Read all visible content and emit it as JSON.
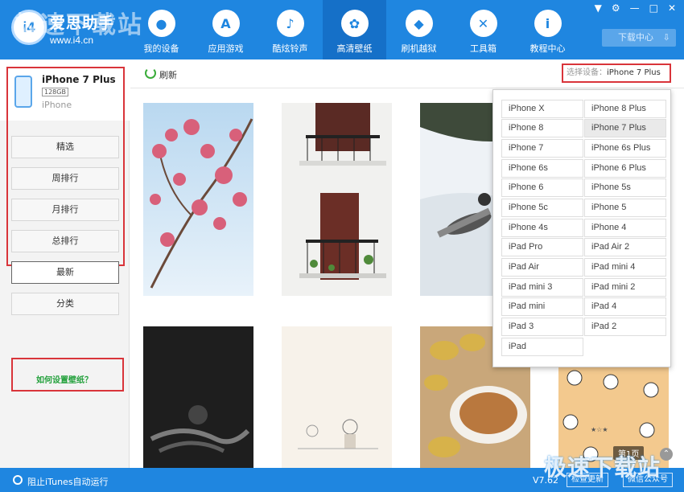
{
  "brand": {
    "name": "爱思助手",
    "url": "www.i4.cn",
    "logo_text": "i4"
  },
  "watermark": {
    "top": "极速下载站",
    "bottom": "极速下载站"
  },
  "nav": [
    {
      "label": "我的设备",
      "icon": "apple-icon"
    },
    {
      "label": "应用游戏",
      "icon": "appstore-icon"
    },
    {
      "label": "酷炫铃声",
      "icon": "bell-icon"
    },
    {
      "label": "高清壁纸",
      "icon": "flower-icon"
    },
    {
      "label": "刷机越狱",
      "icon": "dropbox-icon"
    },
    {
      "label": "工具箱",
      "icon": "tools-icon"
    },
    {
      "label": "教程中心",
      "icon": "info-icon"
    }
  ],
  "download_center": "下载中心",
  "device": {
    "name": "iPhone 7 Plus",
    "capacity": "128GB",
    "model": "iPhone"
  },
  "sidebar": {
    "buttons": [
      "精选",
      "周排行",
      "月排行",
      "总排行",
      "最新",
      "分类"
    ],
    "help": "如何设置壁纸？"
  },
  "toolbar": {
    "refresh": "刷新",
    "select_label": "选择设备：",
    "select_value": "iPhone 7 Plus"
  },
  "dropdown": [
    "iPhone X",
    "iPhone 8 Plus",
    "iPhone 8",
    "iPhone 7 Plus",
    "iPhone 7",
    "iPhone 6s Plus",
    "iPhone 6s",
    "iPhone 6 Plus",
    "iPhone 6",
    "iPhone 5s",
    "iPhone 5c",
    "iPhone 5",
    "iPhone 4s",
    "iPhone 4",
    "iPad Pro",
    "iPad Air 2",
    "iPad Air",
    "iPad mini 4",
    "iPad mini 3",
    "iPad mini 2",
    "iPad mini",
    "iPad 4",
    "iPad 3",
    "iPad 2",
    "iPad"
  ],
  "page_badge": "第1页",
  "status": {
    "itunes": "阻止iTunes自动运行",
    "version": "V7.62",
    "check_update": "检查更新",
    "wechat": "微信公众号"
  },
  "colors": {
    "brand_blue": "#1f86e0",
    "highlight_red": "#d9343a",
    "help_green": "#22a03b"
  }
}
